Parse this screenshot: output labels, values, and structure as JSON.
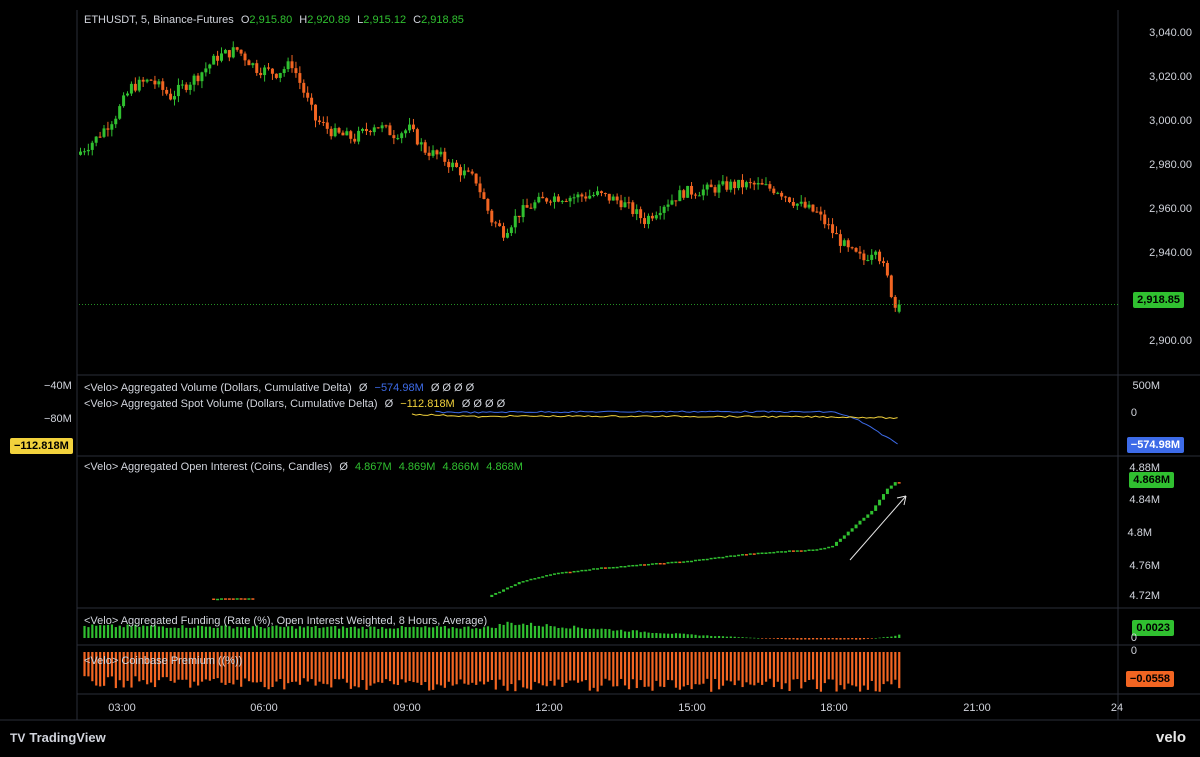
{
  "header": {
    "symbol": "ETHUSDT, 5, Binance-Futures",
    "open_label": "O",
    "open": "2,915.80",
    "high_label": "H",
    "high": "2,920.89",
    "low_label": "L",
    "low": "2,915.12",
    "close_label": "C",
    "close": "2,918.85"
  },
  "panes": {
    "price": {
      "ticks": [
        "3,040.00",
        "3,020.00",
        "3,000.00",
        "2,980.00",
        "2,960.00",
        "2,940.00",
        "2,900.00"
      ],
      "last_tag": "2,918.85"
    },
    "volume": {
      "label1": "<Velo> Aggregated Volume (Dollars, Cumulative Delta)",
      "label1_sym": "Ø",
      "label1_value": "−574.98M",
      "label1_tail": "Ø Ø Ø Ø",
      "label2": "<Velo> Aggregated Spot Volume (Dollars, Cumulative Delta)",
      "label2_sym": "Ø",
      "label2_value": "−112.818M",
      "label2_tail": "Ø Ø Ø Ø",
      "left_ticks": [
        "−40M",
        "−80M"
      ],
      "right_ticks": [
        "500M",
        "0"
      ],
      "left_tag": "−112.818M",
      "right_tag": "−574.98M"
    },
    "oi": {
      "label": "<Velo> Aggregated Open Interest (Coins, Candles)",
      "label_sym": "Ø",
      "values": [
        "4.867M",
        "4.869M",
        "4.866M",
        "4.868M"
      ],
      "ticks": [
        "4.88M",
        "4.84M",
        "4.8M",
        "4.76M",
        "4.72M"
      ],
      "last_tag": "4.868M"
    },
    "funding": {
      "label": "<Velo> Aggregated Funding (Rate (%), Open Interest Weighted, 8 Hours, Average)",
      "ticks": [
        "0"
      ],
      "last_tag": "0.0023"
    },
    "premium": {
      "label": "<Velo> Coinbase Premium ((%))",
      "ticks": [
        "0"
      ],
      "last_tag": "−0.0558"
    }
  },
  "xaxis": {
    "ticks": [
      "03:00",
      "06:00",
      "09:00",
      "12:00",
      "15:00",
      "18:00",
      "21:00",
      "24"
    ]
  },
  "branding": {
    "tradingview": "TradingView",
    "velo": "velo"
  },
  "colors": {
    "up": "#30c030",
    "down": "#f26522",
    "cum_delta": "#3d6be8",
    "spot_delta": "#f2d23c",
    "premium": "#f26522",
    "funding": "#30c030",
    "background": "#000000"
  },
  "chart_data": [
    {
      "type": "candlestick",
      "title": "ETHUSDT, 5, Binance-Futures",
      "x_range": [
        "01:55",
        "24:00"
      ],
      "ylim": [
        2890,
        3045
      ],
      "series": [
        {
          "name": "ETHUSDT",
          "anchor_closes": [
            [
              "01:55",
              2983
            ],
            [
              "02:20",
              2990
            ],
            [
              "02:45",
              3000
            ],
            [
              "03:05",
              3012
            ],
            [
              "03:30",
              3015
            ],
            [
              "03:55",
              3008
            ],
            [
              "04:30",
              3017
            ],
            [
              "04:55",
              3025
            ],
            [
              "05:20",
              3028
            ],
            [
              "05:45",
              3020
            ],
            [
              "06:10",
              3018
            ],
            [
              "06:30",
              3022
            ],
            [
              "06:40",
              3014
            ],
            [
              "07:00",
              2998
            ],
            [
              "07:25",
              2992
            ],
            [
              "07:50",
              2990
            ],
            [
              "08:15",
              2996
            ],
            [
              "08:40",
              2992
            ],
            [
              "09:00",
              2994
            ],
            [
              "09:20",
              2985
            ],
            [
              "09:40",
              2982
            ],
            [
              "10:05",
              2976
            ],
            [
              "10:25",
              2972
            ],
            [
              "10:45",
              2955
            ],
            [
              "11:00",
              2950
            ],
            [
              "11:20",
              2958
            ],
            [
              "11:40",
              2962
            ],
            [
              "12:00",
              2965
            ],
            [
              "12:30",
              2965
            ],
            [
              "13:00",
              2966
            ],
            [
              "13:30",
              2963
            ],
            [
              "14:00",
              2955
            ],
            [
              "14:25",
              2962
            ],
            [
              "14:50",
              2967
            ],
            [
              "15:20",
              2968
            ],
            [
              "15:50",
              2970
            ],
            [
              "16:20",
              2970
            ],
            [
              "16:50",
              2968
            ],
            [
              "17:15",
              2962
            ],
            [
              "17:40",
              2958
            ],
            [
              "18:00",
              2950
            ],
            [
              "18:20",
              2942
            ],
            [
              "18:40",
              2938
            ],
            [
              "18:55",
              2944
            ],
            [
              "19:10",
              2930
            ],
            [
              "19:20",
              2918
            ]
          ],
          "last": {
            "open": 2915.8,
            "high": 2920.89,
            "low": 2915.12,
            "close": 2918.85
          }
        }
      ]
    },
    {
      "type": "line",
      "title": "<Velo> Aggregated Volume (Dollars, Cumulative Delta)",
      "series": [
        {
          "name": "Aggregated Volume (Dollars, Cumulative Delta)",
          "anchors": [
            [
              "09:30",
              0
            ],
            [
              "10:30",
              -10
            ],
            [
              "11:00",
              0
            ],
            [
              "15:00",
              8
            ],
            [
              "18:00",
              0
            ],
            [
              "18:30",
              -150
            ],
            [
              "19:20",
              -574.98
            ]
          ]
        },
        {
          "name": "Aggregated Spot Volume (Dollars, Cumulative Delta)",
          "anchors": [
            [
              "09:00",
              -40
            ],
            [
              "10:00",
              -70
            ],
            [
              "10:30",
              -90
            ],
            [
              "11:00",
              -75
            ],
            [
              "15:00",
              -80
            ],
            [
              "18:00",
              -90
            ],
            [
              "18:50",
              -100
            ],
            [
              "19:20",
              -112.818
            ]
          ]
        }
      ]
    },
    {
      "type": "candlestick",
      "title": "<Velo> Aggregated Open Interest (Coins, Candles)",
      "ylim": [
        4.71,
        4.89
      ],
      "series": [
        {
          "name": "Open Interest",
          "anchors": [
            [
              "04:45",
              4.712
            ],
            [
              "05:40",
              4.712
            ],
            [
              "10:40",
              4.714
            ],
            [
              "11:20",
              4.734
            ],
            [
              "12:00",
              4.745
            ],
            [
              "13:00",
              4.753
            ],
            [
              "14:00",
              4.758
            ],
            [
              "15:00",
              4.763
            ],
            [
              "16:00",
              4.771
            ],
            [
              "17:00",
              4.776
            ],
            [
              "17:40",
              4.778
            ],
            [
              "18:00",
              4.783
            ],
            [
              "18:20",
              4.802
            ],
            [
              "18:50",
              4.83
            ],
            [
              "19:10",
              4.86
            ],
            [
              "19:20",
              4.868
            ]
          ],
          "last": {
            "open": 4.867,
            "high": 4.869,
            "low": 4.866,
            "close": 4.868
          }
        }
      ]
    },
    {
      "type": "bar",
      "title": "<Velo> Aggregated Funding (Rate (%), Open Interest Weighted, 8 Hours, Average)",
      "series": [
        {
          "name": "Funding",
          "anchors": [
            [
              "02:00",
              0.008
            ],
            [
              "08:00",
              0.007
            ],
            [
              "10:40",
              0.007
            ],
            [
              "11:00",
              0.01
            ],
            [
              "13:00",
              0.006
            ],
            [
              "15:00",
              0.002
            ],
            [
              "17:00",
              -0.001
            ],
            [
              "18:30",
              -0.001
            ],
            [
              "19:10",
              0.001
            ],
            [
              "19:20",
              0.0023
            ]
          ]
        }
      ]
    },
    {
      "type": "bar",
      "title": "<Velo> Coinbase Premium ((%))",
      "series": [
        {
          "name": "Coinbase Premium",
          "anchors": [
            [
              "02:00",
              -0.05
            ],
            [
              "12:00",
              -0.055
            ],
            [
              "19:20",
              -0.0558
            ]
          ]
        }
      ]
    }
  ]
}
